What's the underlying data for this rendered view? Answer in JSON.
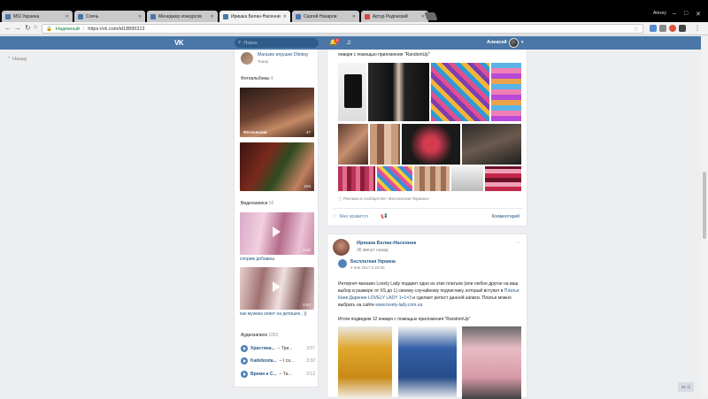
{
  "browser": {
    "tabs": [
      {
        "label": "MSI Украина",
        "fav": "blue",
        "active": false
      },
      {
        "label": "Слечь",
        "fav": "blue",
        "active": false
      },
      {
        "label": "Менеджер конкурсов",
        "fav": "blue",
        "active": false
      },
      {
        "label": "Иришка Белан-Насенник",
        "fav": "blue",
        "active": true
      },
      {
        "label": "Сергей Назаров",
        "fav": "blue",
        "active": false
      },
      {
        "label": "Артур Ридонский",
        "fav": "red",
        "active": false
      }
    ],
    "window_user": "Alexey",
    "secure_label": "Надежный",
    "url": "https://vk.com/id18895313"
  },
  "vk": {
    "logo": "VK",
    "search_placeholder": "Поиск",
    "notif_count": "5",
    "user_name": "Алексей"
  },
  "left": {
    "back_label": "Назад"
  },
  "sidebar": {
    "shop_name": "Магазин игрушек Ditoteg",
    "shop_sub": "Товар",
    "albums_title": "Фотоальбомы",
    "albums_count": "4",
    "album1_caption": "Фотосессия",
    "album1_count": "47",
    "album2_count": "104",
    "videos_title": "Видеозаписи",
    "videos_count": "92",
    "video1_duration": "0:42",
    "video1_label": "спорим добавиш",
    "video2_duration": "0:44",
    "video2_label": "как мужика злиет на детишек.. ))",
    "audio_title": "Аудиозаписи",
    "audio_count": "1052",
    "tracks": [
      {
        "artist": "Христина...",
        "title": "– Три...",
        "duration": "3:07"
      },
      {
        "artist": "Kadebosta...",
        "title": "– I са...",
        "duration": "3:32"
      },
      {
        "artist": "Время и С...",
        "title": "– Та...",
        "duration": "3:12"
      }
    ]
  },
  "post1": {
    "top_text": "января с помощью приложения \"RandomUp\"",
    "ad_label": "Реклама в сообществе «Бесплатная Украина»",
    "like_label": "Мне нравится",
    "comment_label": "Комментарий"
  },
  "post2": {
    "author": "Иришка Белан-Насенник",
    "time": "36 минут назад",
    "repost_name": "Бесплатная Украина",
    "repost_time": "2 янв 2017 в 20:00",
    "body_1": "Интернет-магазин Lovely Lady подарит одно из этих платьев (или любое другое на ваш выбор в размере от XS до L) своему случайному подписчику, который вступит в ",
    "body_link1": "Платье Киев Дарение LOVELY LADY 1+1=3",
    "body_2": " и сделает репост данной записи. Платья можно выбрать на сайте ",
    "body_link2": "www.lovely-lady.com.ua",
    "body_3": "Итоги подведем 12 января с помощью приложения \"RandomUp\""
  },
  "ui": {
    "zoom_badge": "55 ☰"
  }
}
